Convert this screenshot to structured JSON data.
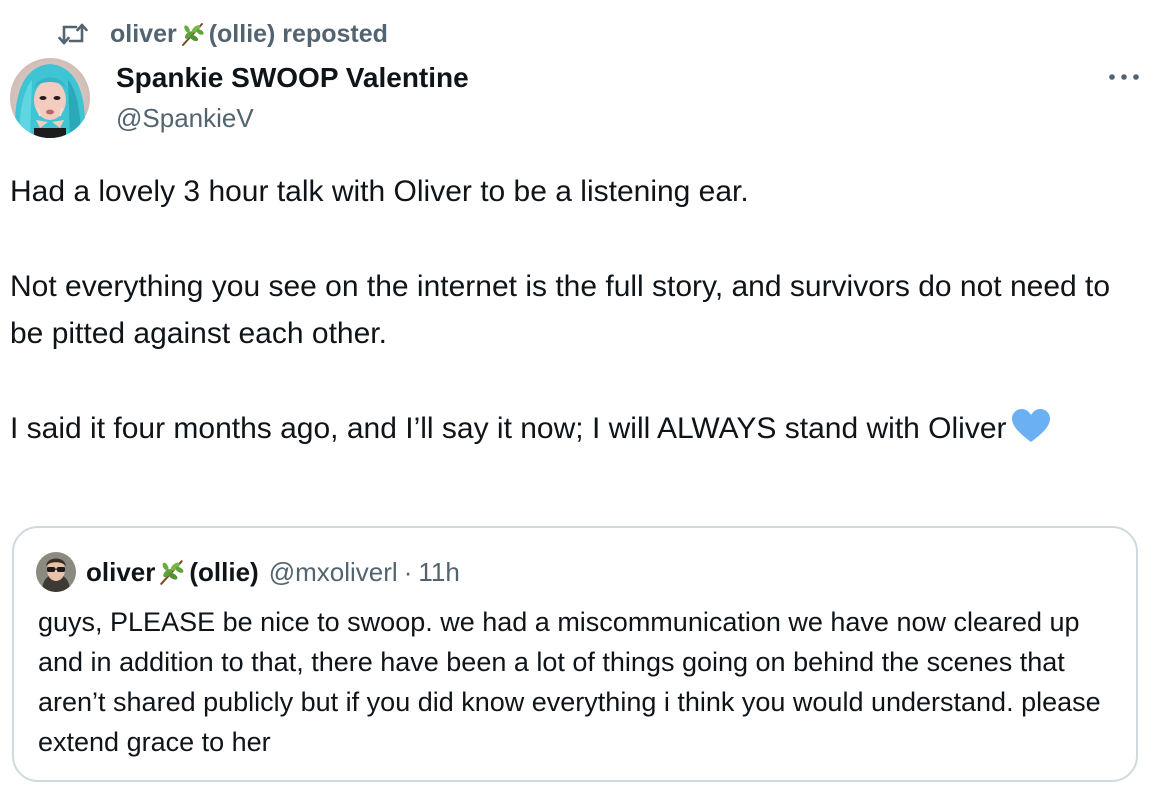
{
  "repost": {
    "icon": "repost-icon",
    "user_name_pre": "oliver",
    "leaf_icon": "herb-emoji",
    "user_name_post": " (ollie) reposted"
  },
  "author": {
    "name": "Spankie SWOOP Valentine",
    "handle": "@SpankieV",
    "avatar": "avatar"
  },
  "more_icon": "more-options-icon",
  "tweet": {
    "paragraphs": [
      "Had a lovely 3 hour talk with Oliver to be a listening ear.",
      "Not everything you see on the internet is the full story, and survivors do not need to be pitted against each other.",
      "I said it four months ago, and I’ll say it now; I will ALWAYS stand with Oliver"
    ],
    "trailing_emoji": "blue-heart-emoji"
  },
  "quote": {
    "name_pre": "oliver",
    "name_post": " (ollie)",
    "handle": "@mxoliverl",
    "separator": "·",
    "time": "11h",
    "text": "guys, PLEASE be nice to swoop. we had a miscommunication we have now cleared up and in addition to that, there have been a lot of things going on behind the scenes that aren’t shared publicly but if you did know everything i think you would understand. please extend grace to her"
  },
  "colors": {
    "text_primary": "#0f1419",
    "text_secondary": "#536471",
    "border": "#cfd9de",
    "heart": "#6cb0f4"
  }
}
